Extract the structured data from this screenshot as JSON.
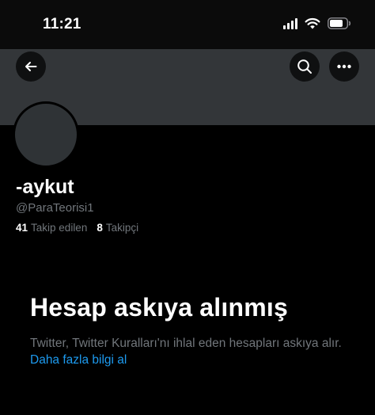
{
  "status_bar": {
    "time": "11:21",
    "icons": [
      "signal-icon",
      "wifi-icon",
      "battery-icon"
    ]
  },
  "header": {
    "banner_color": "#333639",
    "buttons": [
      {
        "name": "back-button",
        "icon": "arrow-left-icon"
      },
      {
        "name": "search-button",
        "icon": "search-icon"
      },
      {
        "name": "more-options-button",
        "icon": "more-horizontal-icon"
      }
    ]
  },
  "profile": {
    "display_name": "-aykut",
    "handle": "@ParaTeorisi1",
    "following_count": "41",
    "following_label": "Takip edilen",
    "followers_count": "8",
    "followers_label": "Takipçi"
  },
  "suspension": {
    "title": "Hesap askıya alınmış",
    "message": "Twitter, Twitter Kuralları'nı ihlal eden hesapları askıya alır.",
    "learn_more": "Daha fazla bilgi al"
  },
  "colors": {
    "background": "#000000",
    "text_primary": "#ffffff",
    "text_secondary": "#71767b",
    "link": "#1d9bf0"
  }
}
